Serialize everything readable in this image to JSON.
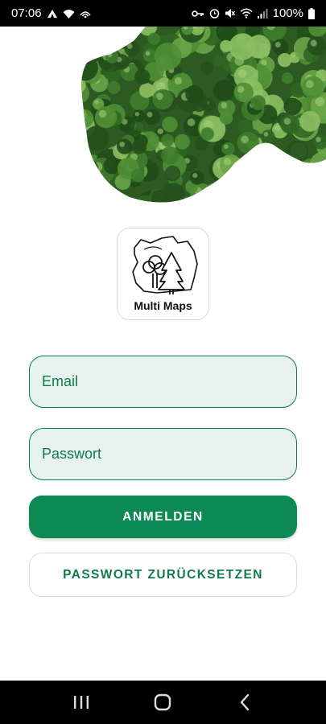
{
  "status_bar": {
    "time": "07:06",
    "battery": "100%",
    "left_icons": [
      "notification-icon",
      "wifi-icon",
      "hotspot-icon"
    ],
    "right_icons": [
      "key-icon",
      "alarm-icon",
      "mute-icon",
      "wifi-icon",
      "signal-icon",
      "battery-icon"
    ]
  },
  "logo": {
    "text": "Multi Maps"
  },
  "form": {
    "email_placeholder": "Email",
    "password_placeholder": "Passwort",
    "login_label": "ANMELDEN",
    "reset_label": "PASSWORT ZURÜCKSETZEN"
  },
  "colors": {
    "primary": "#0b8a54",
    "field_bg": "#e7f1ee",
    "field_border": "#0f7a4a"
  },
  "nav_bar": {
    "buttons": [
      "recents-icon",
      "home-icon",
      "back-icon"
    ]
  }
}
